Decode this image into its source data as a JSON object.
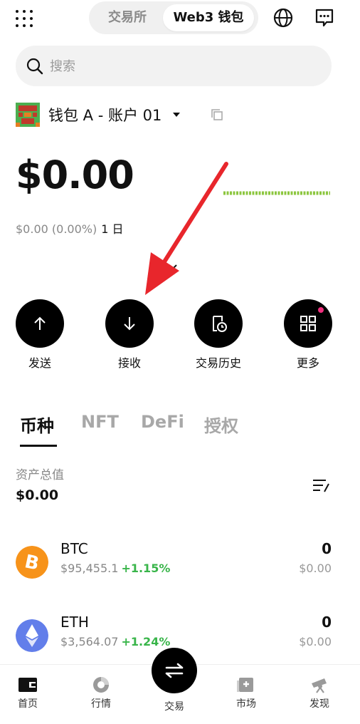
{
  "header": {
    "tabs": [
      {
        "label": "交易所",
        "active": false
      },
      {
        "label": "Web3 钱包",
        "active": true
      }
    ],
    "icons": [
      "grid-menu-icon",
      "globe-icon",
      "chat-icon"
    ]
  },
  "search": {
    "placeholder": "搜索"
  },
  "account": {
    "name": "钱包 A - 账户 01"
  },
  "balance": {
    "total": "$0.00",
    "change": "$0.00 (0.00%)",
    "period": "1 日"
  },
  "actions": [
    {
      "label": "发送",
      "icon": "arrow-up-icon"
    },
    {
      "label": "接收",
      "icon": "arrow-down-icon"
    },
    {
      "label": "交易历史",
      "icon": "history-icon"
    },
    {
      "label": "更多",
      "icon": "apps-icon",
      "badge": true
    }
  ],
  "asset_tabs": [
    {
      "label": "币种",
      "active": true
    },
    {
      "label": "NFT",
      "active": false
    },
    {
      "label": "DeFi",
      "active": false
    },
    {
      "label": "授权",
      "active": false
    }
  ],
  "assets": {
    "total_label": "资产总值",
    "total_value": "$0.00"
  },
  "tokens": [
    {
      "symbol": "BTC",
      "price": "$95,455.1",
      "change": "+1.15%",
      "amount": "0",
      "value": "$0.00",
      "color": "#f7931a"
    },
    {
      "symbol": "ETH",
      "price": "$3,564.07",
      "change": "+1.24%",
      "amount": "0",
      "value": "$0.00",
      "color": "#627eea"
    }
  ],
  "bottom_nav": [
    {
      "label": "首页",
      "icon": "wallet-icon"
    },
    {
      "label": "行情",
      "icon": "chart-icon"
    },
    {
      "label": "交易",
      "icon": "swap-icon"
    },
    {
      "label": "市场",
      "icon": "market-icon"
    },
    {
      "label": "发现",
      "icon": "telescope-icon"
    }
  ],
  "colors": {
    "positive": "#39b54a",
    "sparkline": "#8cc63f",
    "annotation_arrow": "#e8262c",
    "badge": "#ef2f7d"
  }
}
